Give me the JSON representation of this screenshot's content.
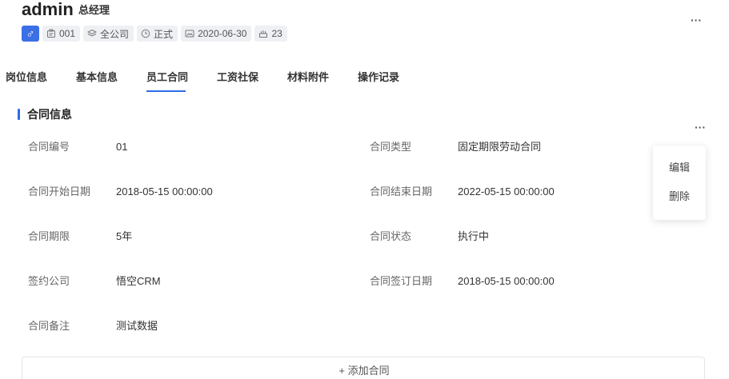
{
  "header": {
    "name": "admin",
    "role": "总经理",
    "more_icon": "ellipsis-icon",
    "tags": [
      {
        "icon": "id-card-icon",
        "text": "001"
      },
      {
        "icon": "layers-icon",
        "text": "全公司"
      },
      {
        "icon": "clock-icon",
        "text": "正式"
      },
      {
        "icon": "image-icon",
        "text": "2020-06-30"
      },
      {
        "icon": "cake-icon",
        "text": "23"
      }
    ],
    "gender_icon": "male-icon",
    "gender_symbol": "♂"
  },
  "tabs": [
    {
      "label": "岗位信息",
      "active": false
    },
    {
      "label": "基本信息",
      "active": false
    },
    {
      "label": "员工合同",
      "active": true
    },
    {
      "label": "工资社保",
      "active": false
    },
    {
      "label": "材料附件",
      "active": false
    },
    {
      "label": "操作记录",
      "active": false
    }
  ],
  "section": {
    "title": "合同信息",
    "fields": [
      {
        "label": "合同编号",
        "value": "01"
      },
      {
        "label": "合同类型",
        "value": "固定期限劳动合同"
      },
      {
        "label": "合同开始日期",
        "value": "2018-05-15 00:00:00"
      },
      {
        "label": "合同结束日期",
        "value": "2022-05-15 00:00:00"
      },
      {
        "label": "合同期限",
        "value": "5年"
      },
      {
        "label": "合同状态",
        "value": "执行中"
      },
      {
        "label": "签约公司",
        "value": "悟空CRM"
      },
      {
        "label": "合同签订日期",
        "value": "2018-05-15 00:00:00"
      },
      {
        "label": "合同备注",
        "value": "测试数据"
      }
    ]
  },
  "dropdown": {
    "items": [
      {
        "label": "编辑"
      },
      {
        "label": "删除"
      }
    ]
  },
  "add_button": {
    "label": "+ 添加合同"
  },
  "colors": {
    "accent": "#2d6de5",
    "gender_badge": "#3b6fe6",
    "tag_bg": "#eef0f4"
  }
}
